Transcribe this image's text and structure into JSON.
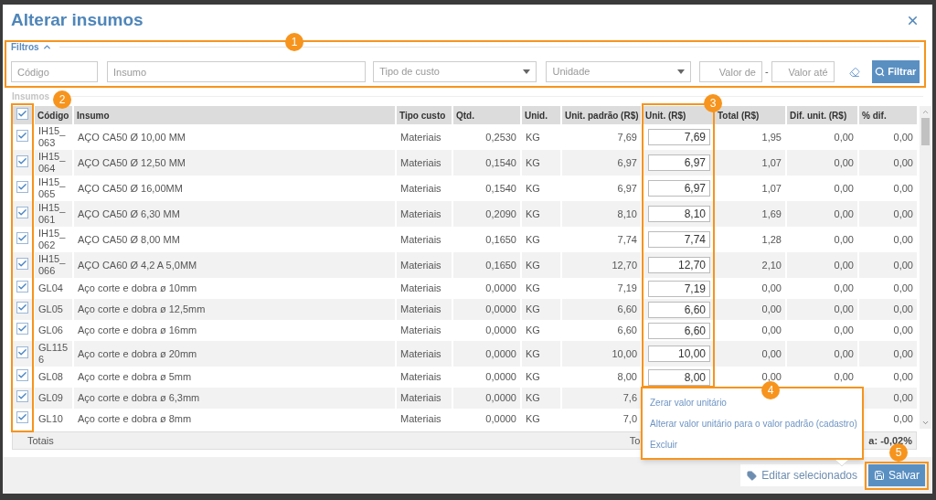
{
  "dialog": {
    "title": "Alterar insumos"
  },
  "filters": {
    "title": "Filtros",
    "expanded": true,
    "fields": [
      {
        "kind": "text",
        "placeholder": "Código"
      },
      {
        "kind": "text",
        "placeholder": "Insumo"
      },
      {
        "kind": "select",
        "placeholder": "Tipo de custo"
      },
      {
        "kind": "select",
        "placeholder": "Unidade"
      },
      {
        "kind": "number",
        "placeholder": "Valor de"
      },
      {
        "kind": "number",
        "placeholder": "Valor até"
      }
    ],
    "range_separator": "-",
    "filter_button": "Filtrar"
  },
  "table": {
    "title": "Insumos",
    "all_checked": true,
    "columns": [
      "Código",
      "Insumo",
      "Tipo custo",
      "Qtd.",
      "Unid.",
      "Unit. padrão (R$)",
      "Unit. (R$)",
      "Total (R$)",
      "Dif. unit. (R$)",
      "% dif."
    ],
    "rows": [
      {
        "checked": true,
        "codigo": "IH15_063",
        "insumo": "AÇO CA50 Ø 10,00 MM",
        "tipo": "Materiais",
        "qtd": "0,2530",
        "unid": "KG",
        "unit_padrao": "7,69",
        "unit": "7,69",
        "total": "1,95",
        "dif_unit": "0,00",
        "pct_dif": "0,00"
      },
      {
        "checked": true,
        "codigo": "IH15_064",
        "insumo": "AÇO CA50 Ø 12,50 MM",
        "tipo": "Materiais",
        "qtd": "0,1540",
        "unid": "KG",
        "unit_padrao": "6,97",
        "unit": "6,97",
        "total": "1,07",
        "dif_unit": "0,00",
        "pct_dif": "0,00"
      },
      {
        "checked": true,
        "codigo": "IH15_065",
        "insumo": "AÇO CA50 Ø 16,00MM",
        "tipo": "Materiais",
        "qtd": "0,1540",
        "unid": "KG",
        "unit_padrao": "6,97",
        "unit": "6,97",
        "total": "1,07",
        "dif_unit": "0,00",
        "pct_dif": "0,00"
      },
      {
        "checked": true,
        "codigo": "IH15_061",
        "insumo": "AÇO CA50 Ø 6,30 MM",
        "tipo": "Materiais",
        "qtd": "0,2090",
        "unid": "KG",
        "unit_padrao": "8,10",
        "unit": "8,10",
        "total": "1,69",
        "dif_unit": "0,00",
        "pct_dif": "0,00"
      },
      {
        "checked": true,
        "codigo": "IH15_062",
        "insumo": "AÇO CA50 Ø 8,00 MM",
        "tipo": "Materiais",
        "qtd": "0,1650",
        "unid": "KG",
        "unit_padrao": "7,74",
        "unit": "7,74",
        "total": "1,28",
        "dif_unit": "0,00",
        "pct_dif": "0,00"
      },
      {
        "checked": true,
        "codigo": "IH15_066",
        "insumo": "AÇO CA60 Ø 4,2 A 5,0MM",
        "tipo": "Materiais",
        "qtd": "0,1650",
        "unid": "KG",
        "unit_padrao": "12,70",
        "unit": "12,70",
        "total": "2,10",
        "dif_unit": "0,00",
        "pct_dif": "0,00"
      },
      {
        "checked": true,
        "codigo": "GL04",
        "insumo": "Aço corte e dobra ø 10mm",
        "tipo": "Materiais",
        "qtd": "0,0000",
        "unid": "KG",
        "unit_padrao": "7,19",
        "unit": "7,19",
        "total": "0,00",
        "dif_unit": "0,00",
        "pct_dif": "0,00"
      },
      {
        "checked": true,
        "codigo": "GL05",
        "insumo": "Aço corte e dobra ø 12,5mm",
        "tipo": "Materiais",
        "qtd": "0,0000",
        "unid": "KG",
        "unit_padrao": "6,60",
        "unit": "6,60",
        "total": "0,00",
        "dif_unit": "0,00",
        "pct_dif": "0,00"
      },
      {
        "checked": true,
        "codigo": "GL06",
        "insumo": "Aço corte e dobra ø 16mm",
        "tipo": "Materiais",
        "qtd": "0,0000",
        "unid": "KG",
        "unit_padrao": "6,60",
        "unit": "6,60",
        "total": "0,00",
        "dif_unit": "0,00",
        "pct_dif": "0,00"
      },
      {
        "checked": true,
        "codigo": "GL1156",
        "insumo": "Aço corte e dobra ø 20mm",
        "tipo": "Materiais",
        "qtd": "0,0000",
        "unid": "KG",
        "unit_padrao": "10,00",
        "unit": "10,00",
        "total": "0,00",
        "dif_unit": "0,00",
        "pct_dif": "0,00"
      },
      {
        "checked": true,
        "codigo": "GL08",
        "insumo": "Aço corte e dobra ø 5mm",
        "tipo": "Materiais",
        "qtd": "0,0000",
        "unid": "KG",
        "unit_padrao": "8,00",
        "unit": "8,00",
        "total": "0,00",
        "dif_unit": "0,00",
        "pct_dif": "0,00"
      },
      {
        "checked": true,
        "codigo": "GL09",
        "insumo": "Aço corte e dobra ø 6,3mm",
        "tipo": "Materiais",
        "qtd": "0,0000",
        "unid": "KG",
        "unit_padrao": "7,6",
        "pct_dif": "0,00"
      },
      {
        "checked": true,
        "codigo": "GL10",
        "insumo": "Aço corte e dobra ø 8mm",
        "tipo": "Materiais",
        "qtd": "0,0000",
        "unid": "KG",
        "unit_padrao": "7,0",
        "pct_dif": "0,00"
      }
    ],
    "totals": {
      "label": "Totais",
      "middle": "To",
      "right": "a: -0,02%"
    }
  },
  "menu": {
    "items": [
      "Zerar valor unitário",
      "Alterar valor unitário para o valor padrão (cadastro)",
      "Excluir"
    ]
  },
  "footer": {
    "buttons": [
      {
        "kind": "secondary",
        "label": "Editar selecionados"
      },
      {
        "kind": "primary",
        "label": "Salvar"
      }
    ]
  },
  "annotations": [
    {
      "number": "1"
    },
    {
      "number": "2"
    },
    {
      "number": "3"
    },
    {
      "number": "4"
    },
    {
      "number": "5"
    }
  ]
}
